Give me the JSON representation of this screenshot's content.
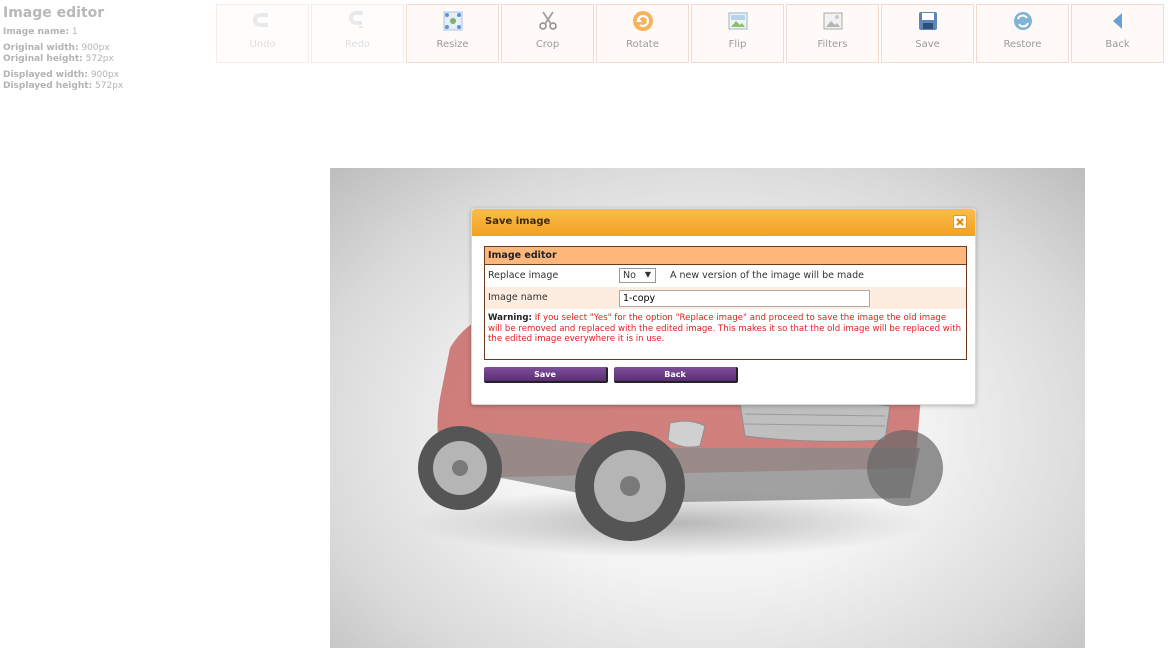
{
  "info": {
    "title": "Image editor",
    "rows": [
      {
        "label": "Image name:",
        "value": "1"
      },
      {
        "label": "Original width:",
        "value": "900px"
      },
      {
        "label": "Original height:",
        "value": "572px"
      },
      {
        "label": "Displayed width:",
        "value": "900px"
      },
      {
        "label": "Displayed height:",
        "value": "572px"
      }
    ]
  },
  "toolbar": {
    "buttons": [
      {
        "label": "Undo",
        "icon": "undo-icon",
        "enabled": false
      },
      {
        "label": "Redo",
        "icon": "redo-icon",
        "enabled": false
      },
      {
        "label": "Resize",
        "icon": "resize-icon",
        "enabled": true
      },
      {
        "label": "Crop",
        "icon": "crop-icon",
        "enabled": true
      },
      {
        "label": "Rotate",
        "icon": "rotate-icon",
        "enabled": true
      },
      {
        "label": "Flip",
        "icon": "flip-icon",
        "enabled": true
      },
      {
        "label": "Filters",
        "icon": "filters-icon",
        "enabled": true
      },
      {
        "label": "Save",
        "icon": "save-icon",
        "enabled": true
      },
      {
        "label": "Restore",
        "icon": "restore-icon",
        "enabled": true
      },
      {
        "label": "Back",
        "icon": "back-icon",
        "enabled": true
      }
    ]
  },
  "dialog": {
    "title": "Save image",
    "form_title": "Image editor",
    "replace_label": "Replace image",
    "replace_value": "No",
    "replace_hint": "A new version of the image will be made",
    "name_label": "Image name",
    "name_value": "1-copy",
    "warning_label": "Warning:",
    "warning_text": "If you select \"Yes\" for the option \"Replace image\" and proceed to save the image the old image will be removed and replaced with the edited image. This makes it so that the old image will be replaced with the edited image everywhere it is in use.",
    "save_label": "Save",
    "back_label": "Back"
  },
  "colors": {
    "dialog_header": "#f3a021",
    "form_header": "#fdb77b",
    "button": "#5a2d74",
    "warning": "#e02020"
  }
}
